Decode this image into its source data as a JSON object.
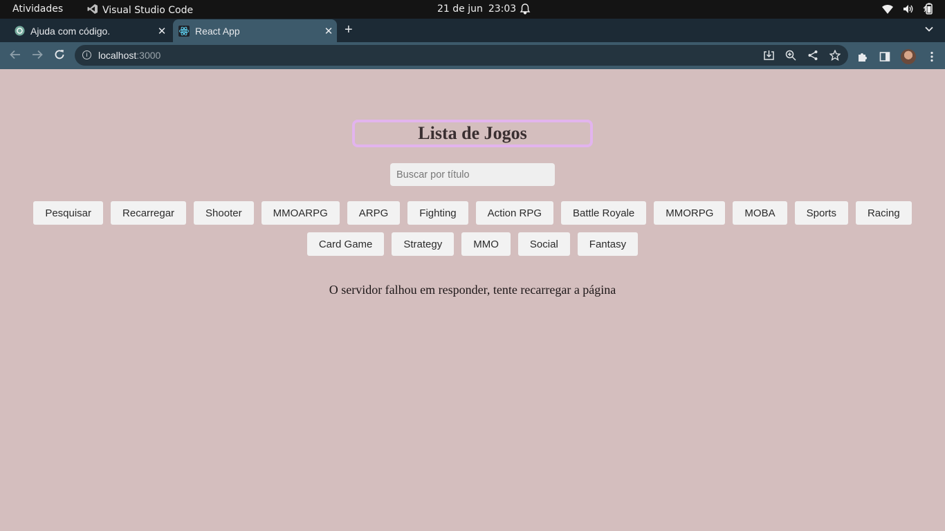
{
  "system_bar": {
    "activities": "Atividades",
    "app_name": "Visual Studio Code",
    "date": "21 de jun",
    "time": "23:03"
  },
  "browser": {
    "tabs": [
      {
        "title": "Ajuda com código.",
        "active": false,
        "favicon": "openai-icon"
      },
      {
        "title": "React App",
        "active": true,
        "favicon": "react-icon"
      }
    ],
    "address": {
      "host": "localhost",
      "port": ":3000"
    }
  },
  "page": {
    "heading": "Lista de Jogos",
    "search_placeholder": "Buscar por título",
    "buttons_row1": [
      "Pesquisar",
      "Recarregar",
      "Shooter",
      "MMOARPG",
      "ARPG",
      "Fighting",
      "Action RPG",
      "Battle Royale",
      "MMORPG",
      "MOBA",
      "Sports",
      "Racing"
    ],
    "buttons_row2": [
      "Card Game",
      "Strategy",
      "MMO",
      "Social",
      "Fantasy"
    ],
    "error_message": "O servidor falhou em responder, tente recarregar a página"
  },
  "colors": {
    "page_background": "#d4bebe",
    "heading_border": "#e2b4ee",
    "browser_toolbar": "#3d5a6b"
  }
}
